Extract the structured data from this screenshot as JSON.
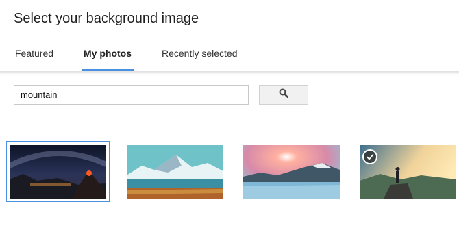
{
  "dialog": {
    "title": "Select your background image"
  },
  "tabs": [
    {
      "label": "Featured",
      "active": false
    },
    {
      "label": "My photos",
      "active": true
    },
    {
      "label": "Recently selected",
      "active": false
    }
  ],
  "search": {
    "value": "mountain",
    "button_icon": "search-icon"
  },
  "images": [
    {
      "subject": "volcano under milky way night sky",
      "selected": true,
      "checkmark": false
    },
    {
      "subject": "snowy mountains over lake",
      "selected": false,
      "checkmark": false
    },
    {
      "subject": "sunset over frozen mountain lake",
      "selected": false,
      "checkmark": false
    },
    {
      "subject": "figure standing on rock at sunrise",
      "selected": false,
      "checkmark": true
    }
  ],
  "colors": {
    "accent": "#4a90e2",
    "title_text": "#202020",
    "input_border": "#c8c8c8",
    "button_bg": "#f1f1f1"
  }
}
